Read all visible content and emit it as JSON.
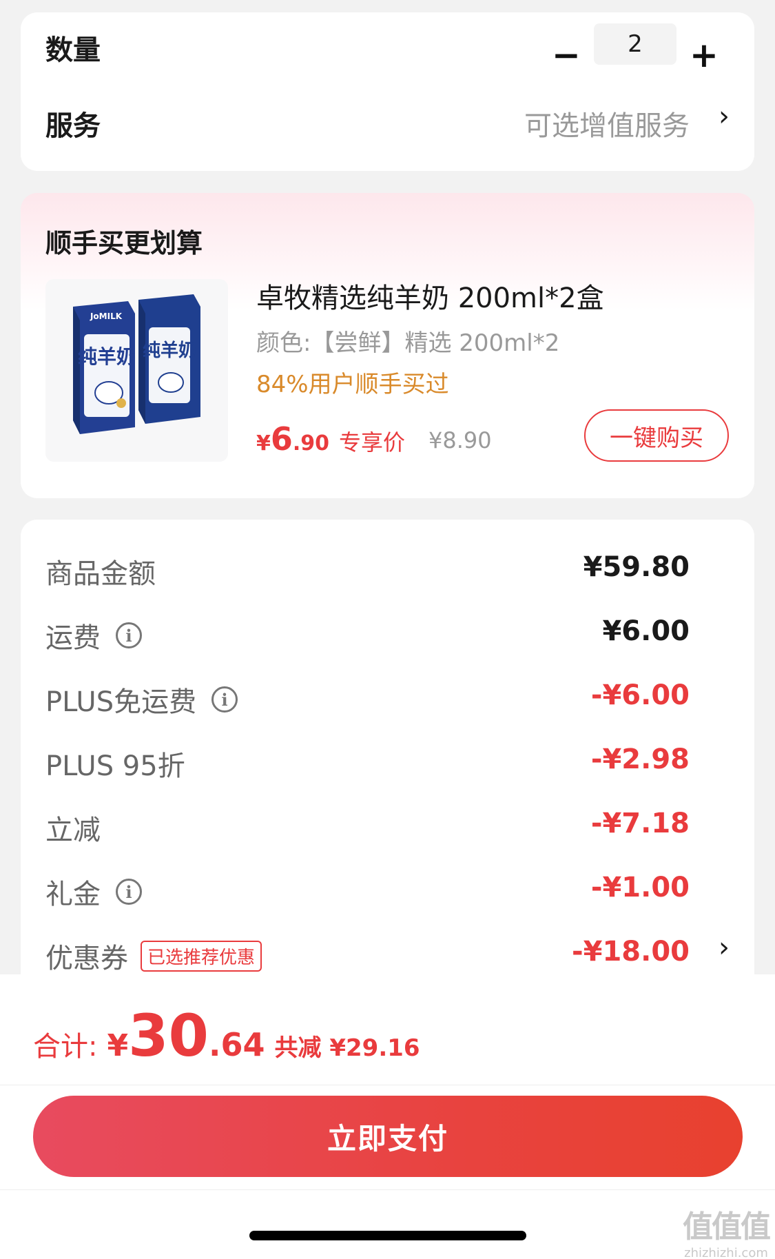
{
  "order": {
    "quantity_label": "数量",
    "quantity_value": "2",
    "minus_symbol": "−",
    "plus_symbol": "+",
    "service_label": "服务",
    "service_value": "可选增值服务",
    "chevron": "›"
  },
  "recommend": {
    "title": "顺手买更划算",
    "product": {
      "name": "卓牧精选纯羊奶 200ml*2盒",
      "spec": "颜色:【尝鲜】精选 200ml*2",
      "bought": "84%用户顺手买过",
      "price_currency": "¥",
      "price_int": "6",
      "price_dec": ".90",
      "price_tag": "专享价",
      "original_price": "¥8.90",
      "buy_button": "一键购买",
      "image_brand": "JoMILK",
      "image_label": "纯羊奶"
    }
  },
  "summary": {
    "rows": [
      {
        "label": "商品金额",
        "value": "¥59.80",
        "info": false,
        "kind": "pos"
      },
      {
        "label": "运费",
        "value": "¥6.00",
        "info": true,
        "kind": "pos"
      },
      {
        "label": "PLUS免运费",
        "value": "-¥6.00",
        "info": true,
        "kind": "neg"
      },
      {
        "label": "PLUS 95折",
        "value": "-¥2.98",
        "info": false,
        "kind": "neg"
      },
      {
        "label": "立减",
        "value": "-¥7.18",
        "info": false,
        "kind": "neg"
      },
      {
        "label": "礼金",
        "value": "-¥1.00",
        "info": true,
        "kind": "neg"
      },
      {
        "label": "优惠券",
        "value": "-¥18.00",
        "info": false,
        "kind": "neg"
      }
    ],
    "coupon_badge": "已选推荐优惠",
    "info_symbol": "i"
  },
  "footer": {
    "total_label": "合计:",
    "total_currency": "¥",
    "total_int": "30",
    "total_dec": ".64",
    "saved_text": "共减 ¥29.16",
    "pay_button": "立即支付",
    "watermark_logo": "值值值",
    "watermark_url": "zhizhizhi.com"
  },
  "colors": {
    "accent": "#e93b3d",
    "bought_orange": "#d98a2b",
    "muted": "#999999"
  }
}
